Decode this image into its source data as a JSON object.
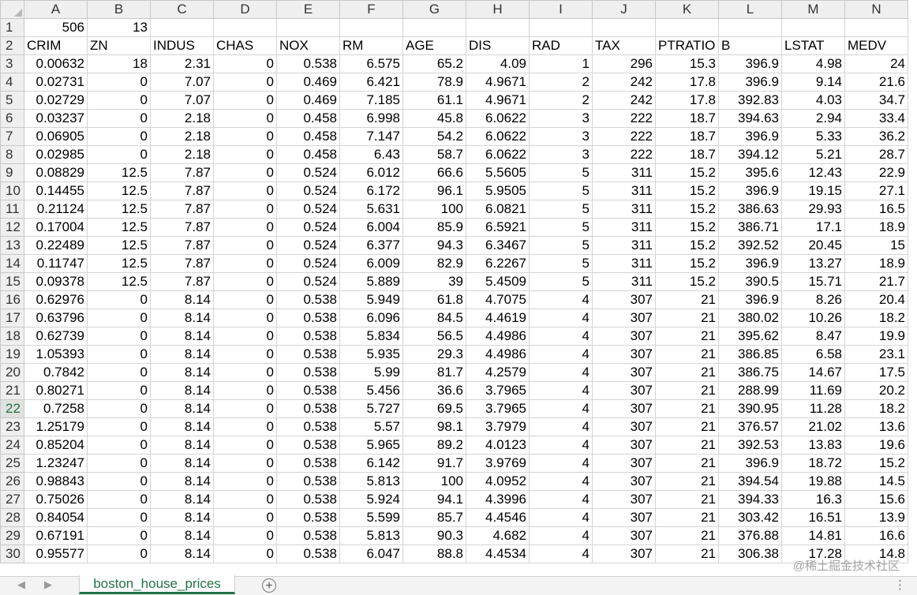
{
  "sheet": {
    "column_headers": [
      "A",
      "B",
      "C",
      "D",
      "E",
      "F",
      "G",
      "H",
      "I",
      "J",
      "K",
      "L",
      "M",
      "N"
    ],
    "active_row": "22",
    "rows": [
      {
        "num": "1",
        "cells": [
          "506",
          "13",
          "",
          "",
          "",
          "",
          "",
          "",
          "",
          "",
          "",
          "",
          "",
          ""
        ]
      },
      {
        "num": "2",
        "cells": [
          "CRIM",
          "ZN",
          "INDUS",
          "CHAS",
          "NOX",
          "RM",
          "AGE",
          "DIS",
          "RAD",
          "TAX",
          "PTRATIO",
          "B",
          "LSTAT",
          "MEDV"
        ]
      },
      {
        "num": "3",
        "cells": [
          "0.00632",
          "18",
          "2.31",
          "0",
          "0.538",
          "6.575",
          "65.2",
          "4.09",
          "1",
          "296",
          "15.3",
          "396.9",
          "4.98",
          "24"
        ]
      },
      {
        "num": "4",
        "cells": [
          "0.02731",
          "0",
          "7.07",
          "0",
          "0.469",
          "6.421",
          "78.9",
          "4.9671",
          "2",
          "242",
          "17.8",
          "396.9",
          "9.14",
          "21.6"
        ]
      },
      {
        "num": "5",
        "cells": [
          "0.02729",
          "0",
          "7.07",
          "0",
          "0.469",
          "7.185",
          "61.1",
          "4.9671",
          "2",
          "242",
          "17.8",
          "392.83",
          "4.03",
          "34.7"
        ]
      },
      {
        "num": "6",
        "cells": [
          "0.03237",
          "0",
          "2.18",
          "0",
          "0.458",
          "6.998",
          "45.8",
          "6.0622",
          "3",
          "222",
          "18.7",
          "394.63",
          "2.94",
          "33.4"
        ]
      },
      {
        "num": "7",
        "cells": [
          "0.06905",
          "0",
          "2.18",
          "0",
          "0.458",
          "7.147",
          "54.2",
          "6.0622",
          "3",
          "222",
          "18.7",
          "396.9",
          "5.33",
          "36.2"
        ]
      },
      {
        "num": "8",
        "cells": [
          "0.02985",
          "0",
          "2.18",
          "0",
          "0.458",
          "6.43",
          "58.7",
          "6.0622",
          "3",
          "222",
          "18.7",
          "394.12",
          "5.21",
          "28.7"
        ]
      },
      {
        "num": "9",
        "cells": [
          "0.08829",
          "12.5",
          "7.87",
          "0",
          "0.524",
          "6.012",
          "66.6",
          "5.5605",
          "5",
          "311",
          "15.2",
          "395.6",
          "12.43",
          "22.9"
        ]
      },
      {
        "num": "10",
        "cells": [
          "0.14455",
          "12.5",
          "7.87",
          "0",
          "0.524",
          "6.172",
          "96.1",
          "5.9505",
          "5",
          "311",
          "15.2",
          "396.9",
          "19.15",
          "27.1"
        ]
      },
      {
        "num": "11",
        "cells": [
          "0.21124",
          "12.5",
          "7.87",
          "0",
          "0.524",
          "5.631",
          "100",
          "6.0821",
          "5",
          "311",
          "15.2",
          "386.63",
          "29.93",
          "16.5"
        ]
      },
      {
        "num": "12",
        "cells": [
          "0.17004",
          "12.5",
          "7.87",
          "0",
          "0.524",
          "6.004",
          "85.9",
          "6.5921",
          "5",
          "311",
          "15.2",
          "386.71",
          "17.1",
          "18.9"
        ]
      },
      {
        "num": "13",
        "cells": [
          "0.22489",
          "12.5",
          "7.87",
          "0",
          "0.524",
          "6.377",
          "94.3",
          "6.3467",
          "5",
          "311",
          "15.2",
          "392.52",
          "20.45",
          "15"
        ]
      },
      {
        "num": "14",
        "cells": [
          "0.11747",
          "12.5",
          "7.87",
          "0",
          "0.524",
          "6.009",
          "82.9",
          "6.2267",
          "5",
          "311",
          "15.2",
          "396.9",
          "13.27",
          "18.9"
        ]
      },
      {
        "num": "15",
        "cells": [
          "0.09378",
          "12.5",
          "7.87",
          "0",
          "0.524",
          "5.889",
          "39",
          "5.4509",
          "5",
          "311",
          "15.2",
          "390.5",
          "15.71",
          "21.7"
        ]
      },
      {
        "num": "16",
        "cells": [
          "0.62976",
          "0",
          "8.14",
          "0",
          "0.538",
          "5.949",
          "61.8",
          "4.7075",
          "4",
          "307",
          "21",
          "396.9",
          "8.26",
          "20.4"
        ]
      },
      {
        "num": "17",
        "cells": [
          "0.63796",
          "0",
          "8.14",
          "0",
          "0.538",
          "6.096",
          "84.5",
          "4.4619",
          "4",
          "307",
          "21",
          "380.02",
          "10.26",
          "18.2"
        ]
      },
      {
        "num": "18",
        "cells": [
          "0.62739",
          "0",
          "8.14",
          "0",
          "0.538",
          "5.834",
          "56.5",
          "4.4986",
          "4",
          "307",
          "21",
          "395.62",
          "8.47",
          "19.9"
        ]
      },
      {
        "num": "19",
        "cells": [
          "1.05393",
          "0",
          "8.14",
          "0",
          "0.538",
          "5.935",
          "29.3",
          "4.4986",
          "4",
          "307",
          "21",
          "386.85",
          "6.58",
          "23.1"
        ]
      },
      {
        "num": "20",
        "cells": [
          "0.7842",
          "0",
          "8.14",
          "0",
          "0.538",
          "5.99",
          "81.7",
          "4.2579",
          "4",
          "307",
          "21",
          "386.75",
          "14.67",
          "17.5"
        ]
      },
      {
        "num": "21",
        "cells": [
          "0.80271",
          "0",
          "8.14",
          "0",
          "0.538",
          "5.456",
          "36.6",
          "3.7965",
          "4",
          "307",
          "21",
          "288.99",
          "11.69",
          "20.2"
        ]
      },
      {
        "num": "22",
        "cells": [
          "0.7258",
          "0",
          "8.14",
          "0",
          "0.538",
          "5.727",
          "69.5",
          "3.7965",
          "4",
          "307",
          "21",
          "390.95",
          "11.28",
          "18.2"
        ]
      },
      {
        "num": "23",
        "cells": [
          "1.25179",
          "0",
          "8.14",
          "0",
          "0.538",
          "5.57",
          "98.1",
          "3.7979",
          "4",
          "307",
          "21",
          "376.57",
          "21.02",
          "13.6"
        ]
      },
      {
        "num": "24",
        "cells": [
          "0.85204",
          "0",
          "8.14",
          "0",
          "0.538",
          "5.965",
          "89.2",
          "4.0123",
          "4",
          "307",
          "21",
          "392.53",
          "13.83",
          "19.6"
        ]
      },
      {
        "num": "25",
        "cells": [
          "1.23247",
          "0",
          "8.14",
          "0",
          "0.538",
          "6.142",
          "91.7",
          "3.9769",
          "4",
          "307",
          "21",
          "396.9",
          "18.72",
          "15.2"
        ]
      },
      {
        "num": "26",
        "cells": [
          "0.98843",
          "0",
          "8.14",
          "0",
          "0.538",
          "5.813",
          "100",
          "4.0952",
          "4",
          "307",
          "21",
          "394.54",
          "19.88",
          "14.5"
        ]
      },
      {
        "num": "27",
        "cells": [
          "0.75026",
          "0",
          "8.14",
          "0",
          "0.538",
          "5.924",
          "94.1",
          "4.3996",
          "4",
          "307",
          "21",
          "394.33",
          "16.3",
          "15.6"
        ]
      },
      {
        "num": "28",
        "cells": [
          "0.84054",
          "0",
          "8.14",
          "0",
          "0.538",
          "5.599",
          "85.7",
          "4.4546",
          "4",
          "307",
          "21",
          "303.42",
          "16.51",
          "13.9"
        ]
      },
      {
        "num": "29",
        "cells": [
          "0.67191",
          "0",
          "8.14",
          "0",
          "0.538",
          "5.813",
          "90.3",
          "4.682",
          "4",
          "307",
          "21",
          "376.88",
          "14.81",
          "16.6"
        ]
      },
      {
        "num": "30",
        "cells": [
          "0.95577",
          "0",
          "8.14",
          "0",
          "0.538",
          "6.047",
          "88.8",
          "4.4534",
          "4",
          "307",
          "21",
          "306.38",
          "17.28",
          "14.8"
        ]
      }
    ]
  },
  "tabs": {
    "prev_icon": "◀",
    "next_icon": "▶",
    "sheet_name": "boston_house_prices",
    "add_icon": "+",
    "more_icon": "⋮"
  },
  "watermark": "@稀土掘金技术社区"
}
